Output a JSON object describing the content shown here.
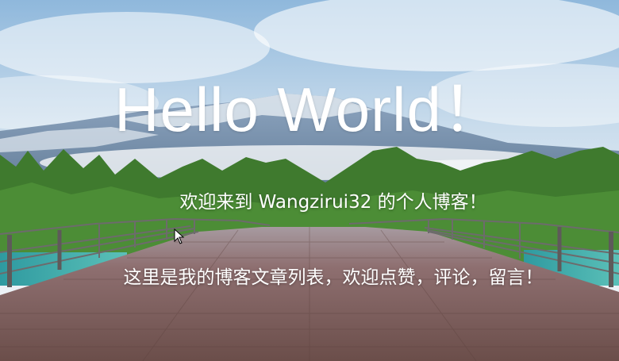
{
  "hero": {
    "title": "Hello World！",
    "welcome": "欢迎来到 Wangzirui32 的个人博客！",
    "subtitle": "这里是我的博客文章列表，欢迎点赞，评论，留言！"
  },
  "background": {
    "scene": "mountain-bridge-landscape",
    "sky_color": "#b9d3ea",
    "forest_color": "#3d7a2c",
    "bridge_color": "#8a6a6a",
    "water_color": "#3aa7a4"
  },
  "cursor": {
    "icon": "mouse-pointer-icon"
  }
}
